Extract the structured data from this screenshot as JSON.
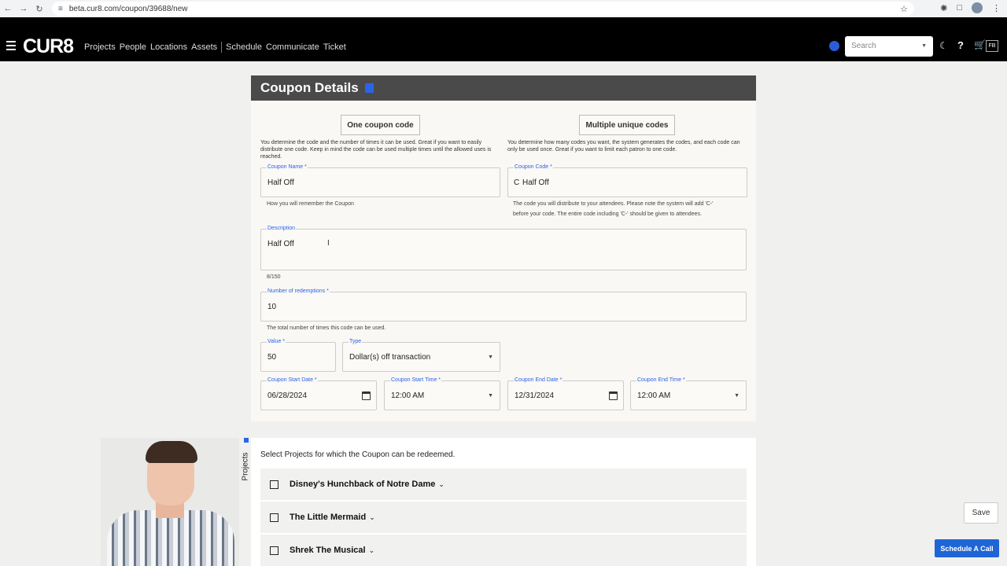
{
  "browser": {
    "url": "beta.cur8.com/coupon/39688/new"
  },
  "header": {
    "logo": "CUR8",
    "nav": [
      "Projects",
      "People",
      "Locations",
      "Assets",
      "Schedule",
      "Communicate",
      "Ticket"
    ],
    "search_placeholder": "Search",
    "user_initials": "FB"
  },
  "coupon": {
    "title": "Coupon Details",
    "modes": [
      {
        "label": "One coupon code",
        "desc": "You determine the code and the number of times it can be used. Great if you want to easily distribute one code. Keep in mind the code can be used multiple times until the allowed uses is reached."
      },
      {
        "label": "Multiple unique codes",
        "desc": "You determine how many codes you want, the system generates the codes, and each code can only be used once. Great if you want to limit each patron to one code."
      }
    ],
    "name": {
      "label": "Coupon Name *",
      "value": "Half Off",
      "helper": "How you will remember the Coupon"
    },
    "code": {
      "label": "Coupon Code *",
      "prefix": "C",
      "value": "Half Off",
      "helper1": "The code you will distribute to your attendees. Please note the system will add 'C-'",
      "helper2": "before your code. The entire code including 'C-' should be given to attendees."
    },
    "description": {
      "label": "Description",
      "value": "Half Off",
      "counter": "8/150"
    },
    "redemptions": {
      "label": "Number of redemptions *",
      "value": "10",
      "helper": "The total number of times this code can be used."
    },
    "value_field": {
      "label": "Value *",
      "value": "50"
    },
    "type_field": {
      "label": "Type",
      "value": "Dollar(s) off transaction"
    },
    "start_date": {
      "label": "Coupon Start Date *",
      "value": "06/28/2024"
    },
    "start_time": {
      "label": "Coupon Start Time *",
      "value": "12:00 AM"
    },
    "end_date": {
      "label": "Coupon End Date *",
      "value": "12/31/2024"
    },
    "end_time": {
      "label": "Coupon End Time *",
      "value": "12:00 AM"
    }
  },
  "projects": {
    "tab_label": "Projects",
    "title": "Select Projects for which the Coupon can be redeemed.",
    "items": [
      "Disney's Hunchback of Notre Dame",
      "The Little Mermaid",
      "Shrek The Musical"
    ]
  },
  "actions": {
    "save": "Save",
    "schedule": "Schedule A Call"
  },
  "colors": {
    "accent": "#2a64e8",
    "header_bg": "#000000",
    "card_header_bg": "#4a4a4a",
    "schedule_btn": "#1e65d6"
  }
}
